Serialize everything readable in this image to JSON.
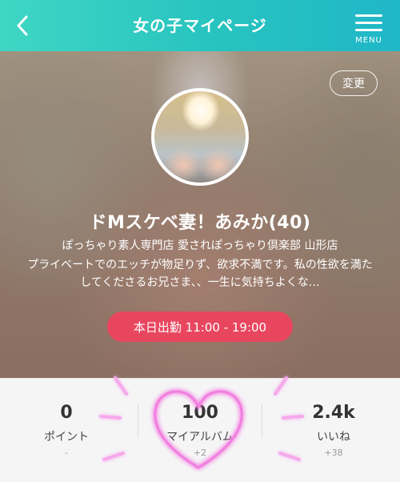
{
  "header": {
    "title": "女の子マイページ",
    "menu_label": "MENU",
    "back_icon": "chevron-left-icon",
    "menu_icon": "hamburger-menu-icon",
    "bg_color": "#27c3bf"
  },
  "profile": {
    "change_label": "変更",
    "name": "ドMスケベ妻！あみか(40)",
    "shop": "ぽっちゃり素人専門店 愛されぽっちゃり倶楽部 山形店",
    "description": "プライベートでのエッチが物足りず、欲求不満です。私の性欲を満たしてくださるお兄さま、、一生に気持ちよくな…",
    "shift": "本日出勤 11:00 - 19:00",
    "shift_color": "#e8465f"
  },
  "stats": [
    {
      "value": "0",
      "label": "ポイント",
      "sub": "-"
    },
    {
      "value": "100",
      "label": "マイアルバム",
      "sub": "+2"
    },
    {
      "value": "2.4k",
      "label": "いいね",
      "sub": "+38"
    }
  ],
  "highlight_color": "#f27ee0"
}
